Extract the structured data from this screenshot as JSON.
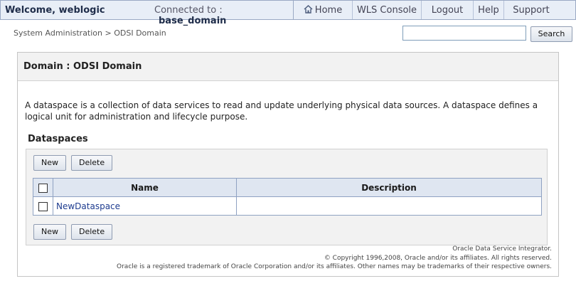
{
  "header": {
    "welcome": "Welcome, weblogic",
    "connected_label": "Connected to :",
    "domain": "base_domain",
    "nav": {
      "home": "Home",
      "wls_console": "WLS Console",
      "logout": "Logout",
      "help": "Help",
      "support": "Support"
    }
  },
  "breadcrumb": "System Administration > ODSI Domain",
  "search": {
    "value": "",
    "button": "Search"
  },
  "panel": {
    "title": "Domain : ODSI Domain",
    "description": "A dataspace is a collection of data services to read and update underlying physical data sources. A dataspace defines a logical unit for administration and lifecycle purpose.",
    "section_title": "Dataspaces",
    "buttons": {
      "new": "New",
      "delete": "Delete"
    },
    "table": {
      "columns": [
        "Name",
        "Description"
      ],
      "rows": [
        {
          "name": "NewDataspace",
          "description": ""
        }
      ]
    }
  },
  "footer": {
    "line1": "Oracle Data Service Integrator.",
    "line2": "© Copyright 1996,2008, Oracle and/or its affiliates. All rights reserved.",
    "line3": "Oracle is a registered trademark of Oracle Corporation and/or its affiliates. Other names may be trademarks of their respective owners."
  }
}
